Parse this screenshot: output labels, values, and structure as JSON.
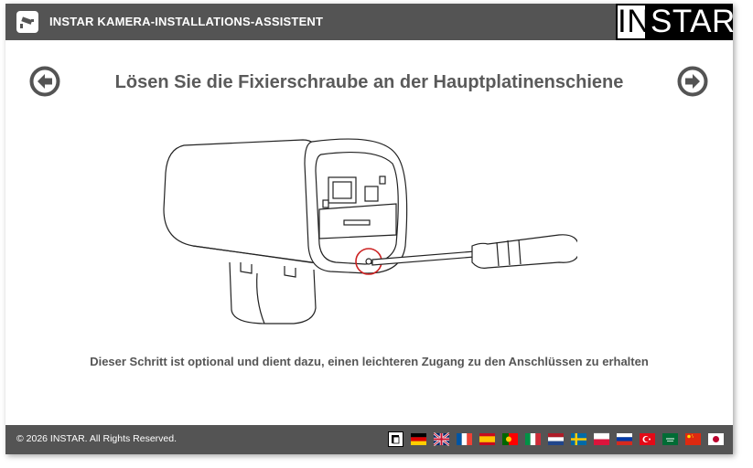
{
  "header": {
    "title": "INSTAR KAMERA-INSTALLATIONS-ASSISTENT",
    "logo_in": "IN",
    "logo_star": "STAR",
    "app_icon": "camera-icon"
  },
  "main": {
    "title": "Lösen Sie die Fixierschraube an der Hauptplatinenschiene",
    "caption": "Dieser Schritt ist optional und dient dazu, einen leichteren Zugang zu den Anschlüssen zu erhalten",
    "prev_icon": "arrow-left-circle-icon",
    "next_icon": "arrow-right-circle-icon",
    "illustration": "camera-screwdriver-illustration"
  },
  "footer": {
    "copyright": "© 2026 INSTAR. All Rights Reserved.",
    "languages": [
      "install-icon",
      "de",
      "en",
      "fr",
      "es",
      "pt",
      "it",
      "nl",
      "se",
      "pl",
      "ru",
      "tr",
      "ar",
      "cn",
      "jp"
    ]
  },
  "colors": {
    "header_bg": "#545454",
    "footer_bg": "#545454",
    "title_text": "#5a5a5a",
    "highlight": "#cc2222"
  }
}
